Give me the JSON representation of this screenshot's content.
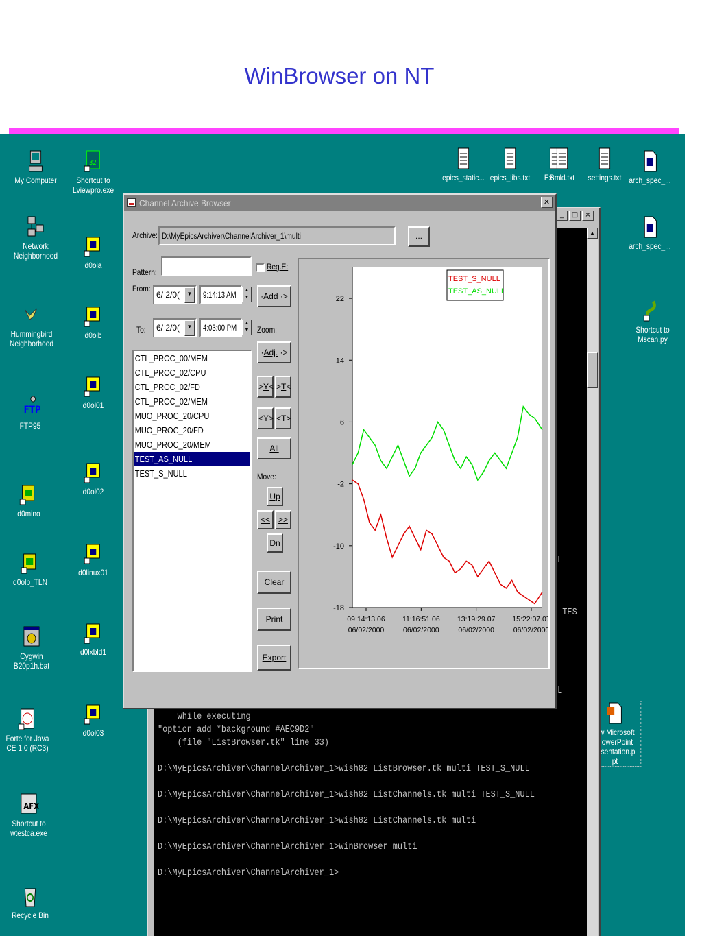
{
  "slide": {
    "title": "WinBrowser on NT"
  },
  "desktop_icons": {
    "my_computer": "My Computer",
    "network": [
      "Network",
      "Neighborhood"
    ],
    "hummingbird": [
      "Hummingbird",
      "Neighborhood"
    ],
    "ftp95": "FTP95",
    "d0mino": "d0mino",
    "d0olb_tln": "d0olb_TLN",
    "cygwin": [
      "Cygwin",
      "B20p1h.bat"
    ],
    "forte": [
      "Forte for Java",
      "CE 1.0 (RC3)"
    ],
    "wtestca": [
      "Shortcut to",
      "wtestca.exe"
    ],
    "recycle": "Recycle Bin",
    "lviewpro": [
      "Shortcut to",
      "Lviewpro.exe"
    ],
    "d0ola": "d0ola",
    "d0olb": "d0olb",
    "d0ol01": "d0ol01",
    "d0ol02": "d0ol02",
    "d0linux01": "d0linux01",
    "d0lxbld1": "d0lxbld1",
    "d0ol03": "d0ol03",
    "top_files": [
      "epics_static...",
      "epics_libs.txt",
      "Extra...",
      "Build.txt",
      "settings.txt"
    ],
    "arch_spec_1": "arch_spec_...",
    "arch_spec_2": "arch_spec_...",
    "mscan": [
      "Shortcut to",
      "Mscan.py"
    ],
    "ppt": [
      "ew Microsoft",
      "PowerPoint",
      "resentation.p",
      "pt"
    ],
    "lviewpro_badge": "32"
  },
  "cmd": {
    "lines_partial": [
      "LL",
      "L",
      "L TES",
      "LL"
    ],
    "lines": [
      "    while executing",
      "\"option add *background #AEC9D2\"",
      "    (file \"ListBrowser.tk\" line 33)",
      "",
      "D:\\MyEpicsArchiver\\ChannelArchiver_1>wish82 ListBrowser.tk multi TEST_S_NULL",
      "",
      "D:\\MyEpicsArchiver\\ChannelArchiver_1>wish82 ListChannels.tk multi TEST_S_NULL",
      "",
      "D:\\MyEpicsArchiver\\ChannelArchiver_1>wish82 ListChannels.tk multi",
      "",
      "D:\\MyEpicsArchiver\\ChannelArchiver_1>WinBrowser multi",
      "",
      "D:\\MyEpicsArchiver\\ChannelArchiver_1>"
    ]
  },
  "dialog": {
    "title": "Channel Archive Browser",
    "archive_label": "Archive:",
    "archive_value": "D:\\MyEpicsArchiver\\ChannelArchiver_1\\multi",
    "browse_label": "...",
    "pattern_label": "Pattern:",
    "pattern_value": "",
    "regex_label": "Reg.E:",
    "from_label": "From:",
    "from_date": "6/ 2/0(",
    "from_time": "9:14:13 AM",
    "to_label": "To:",
    "to_date": "6/ 2/0(",
    "to_time": "4:03:00 PM",
    "add_label": "Add",
    "zoom_label": "Zoom:",
    "adj_label": "Adj.",
    "y_zoom": "Y",
    "t_zoom": "T",
    "y_zoom2": "Y",
    "t_zoom2": "T",
    "all_label": "All",
    "move_label": "Move:",
    "up_label": "Up",
    "left_label": "<<",
    "right_label": ">>",
    "dn_label": "Dn",
    "clear_label": "Clear",
    "print_label": "Print",
    "export_label": "Export",
    "channels": [
      "CTL_PROC_00/MEM",
      "CTL_PROC_02/CPU",
      "CTL_PROC_02/FD",
      "CTL_PROC_02/MEM",
      "MUO_PROC_20/CPU",
      "MUO_PROC_20/FD",
      "MUO_PROC_20/MEM",
      "TEST_AS_NULL",
      "TEST_S_NULL"
    ],
    "selected_channel": "TEST_AS_NULL"
  },
  "chart_data": {
    "type": "line",
    "ylim": [
      -18,
      26
    ],
    "yticks": [
      22,
      14,
      6,
      -2,
      -10,
      -18
    ],
    "xticks": [
      {
        "time": "09:14:13.06",
        "date": "06/02/2000"
      },
      {
        "time": "11:16:51.06",
        "date": "06/02/2000"
      },
      {
        "time": "13:19:29.07",
        "date": "06/02/2000"
      },
      {
        "time": "15:22:07.07",
        "date": "06/02/2000"
      }
    ],
    "legend_position": "top-right",
    "series": [
      {
        "name": "TEST_S_NULL",
        "color": "#dd0000",
        "points": [
          [
            0,
            -1.5
          ],
          [
            0.03,
            -2
          ],
          [
            0.06,
            -4
          ],
          [
            0.09,
            -7
          ],
          [
            0.12,
            -8
          ],
          [
            0.15,
            -6
          ],
          [
            0.18,
            -9
          ],
          [
            0.21,
            -11.5
          ],
          [
            0.24,
            -10
          ],
          [
            0.27,
            -8.5
          ],
          [
            0.3,
            -7.5
          ],
          [
            0.33,
            -9
          ],
          [
            0.36,
            -10.5
          ],
          [
            0.39,
            -8
          ],
          [
            0.42,
            -8.5
          ],
          [
            0.45,
            -10
          ],
          [
            0.48,
            -11.5
          ],
          [
            0.51,
            -12
          ],
          [
            0.54,
            -13.5
          ],
          [
            0.57,
            -13
          ],
          [
            0.6,
            -12
          ],
          [
            0.63,
            -12.5
          ],
          [
            0.66,
            -14
          ],
          [
            0.69,
            -13
          ],
          [
            0.72,
            -12
          ],
          [
            0.75,
            -13.5
          ],
          [
            0.78,
            -15
          ],
          [
            0.81,
            -15.5
          ],
          [
            0.84,
            -14.5
          ],
          [
            0.87,
            -16
          ],
          [
            0.9,
            -16.5
          ],
          [
            0.93,
            -17
          ],
          [
            0.96,
            -17.5
          ],
          [
            1.0,
            -16
          ]
        ]
      },
      {
        "name": "TEST_AS_NULL",
        "color": "#00dd00",
        "points": [
          [
            0,
            0.5
          ],
          [
            0.03,
            2
          ],
          [
            0.06,
            5
          ],
          [
            0.09,
            4
          ],
          [
            0.12,
            3
          ],
          [
            0.15,
            1
          ],
          [
            0.18,
            0
          ],
          [
            0.21,
            1.5
          ],
          [
            0.24,
            3
          ],
          [
            0.27,
            1
          ],
          [
            0.3,
            -1
          ],
          [
            0.33,
            0
          ],
          [
            0.36,
            2
          ],
          [
            0.39,
            3
          ],
          [
            0.42,
            4
          ],
          [
            0.45,
            6
          ],
          [
            0.48,
            5
          ],
          [
            0.51,
            3
          ],
          [
            0.54,
            1
          ],
          [
            0.57,
            0
          ],
          [
            0.6,
            1.5
          ],
          [
            0.63,
            0.5
          ],
          [
            0.66,
            -1.5
          ],
          [
            0.69,
            -0.5
          ],
          [
            0.72,
            1
          ],
          [
            0.75,
            2
          ],
          [
            0.78,
            1
          ],
          [
            0.81,
            0
          ],
          [
            0.84,
            2
          ],
          [
            0.87,
            4
          ],
          [
            0.9,
            8
          ],
          [
            0.93,
            7
          ],
          [
            0.96,
            6.5
          ],
          [
            1.0,
            5
          ]
        ]
      }
    ]
  }
}
